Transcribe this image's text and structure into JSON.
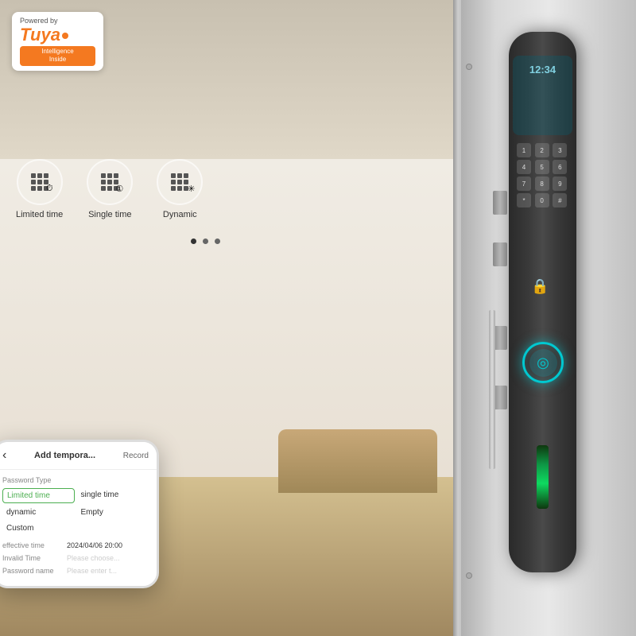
{
  "tuya": {
    "powered_by": "Powered by",
    "logo": "Tuya",
    "tagline": "Intelligence\nInside"
  },
  "features": [
    {
      "label": "Limited time",
      "icon": "grid-clock"
    },
    {
      "label": "Single time",
      "icon": "grid-1-clock"
    },
    {
      "label": "Dynamic",
      "icon": "grid-sun"
    }
  ],
  "phone": {
    "back_icon": "‹",
    "title": "Add tempora...",
    "record_label": "Record",
    "section_label": "Password Type",
    "password_types": [
      {
        "text": "Limited time",
        "selected": true
      },
      {
        "text": "single time",
        "selected": false
      },
      {
        "text": "dynamic",
        "selected": false
      },
      {
        "text": "Empty",
        "selected": false
      },
      {
        "text": "Custom",
        "selected": false
      }
    ],
    "fields": [
      {
        "label": "effective time",
        "value": "2024/04/06\n20:00",
        "is_placeholder": false
      },
      {
        "label": "Invalid Time",
        "value": "Please choose...",
        "is_placeholder": true
      },
      {
        "label": "Password name",
        "value": "Please enter t...",
        "is_placeholder": true
      }
    ]
  },
  "lock": {
    "time_display": "12:34",
    "keypad_keys": [
      "1",
      "2",
      "3",
      "4",
      "5",
      "6",
      "7",
      "8",
      "9",
      "*",
      "0",
      "#"
    ]
  },
  "dots": [
    {
      "active": true
    },
    {
      "active": false
    },
    {
      "active": false
    }
  ]
}
